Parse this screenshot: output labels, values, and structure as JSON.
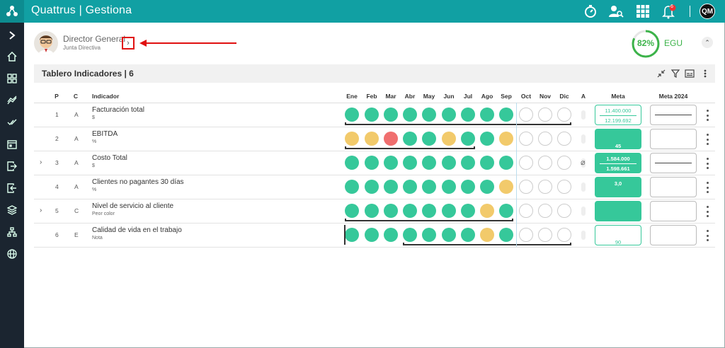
{
  "app": {
    "title": "Quattrus | Gestiona",
    "user_initials": "QM",
    "notifications": "6"
  },
  "profile": {
    "role": "Director General",
    "unit": "Junta Directiva",
    "score": "82%",
    "score_value": 82,
    "score_label": "EGU"
  },
  "panel": {
    "title": "Tablero Indicadores | 6"
  },
  "columns": {
    "p": "P",
    "c": "C",
    "indicador": "Indicador",
    "months": [
      "Ene",
      "Feb",
      "Mar",
      "Abr",
      "May",
      "Jun",
      "Jul",
      "Ago",
      "Sep",
      "Oct",
      "Nov",
      "Dic"
    ],
    "a": "A",
    "meta": "Meta",
    "meta_year": "Meta 2024"
  },
  "rows": [
    {
      "p": "1",
      "c": "A",
      "name": "Facturación total",
      "unit": "$",
      "status": [
        "g",
        "g",
        "g",
        "g",
        "g",
        "g",
        "g",
        "g",
        "g",
        "e",
        "e",
        "e"
      ],
      "meta_top": "11.400.000",
      "meta_bottom": "12.199.692",
      "meta_style": "outline2",
      "expand": false
    },
    {
      "p": "2",
      "c": "A",
      "name": "EBITDA",
      "unit": "%",
      "status": [
        "y",
        "y",
        "r",
        "g",
        "g",
        "y",
        "g",
        "g",
        "y",
        "e",
        "e",
        "e"
      ],
      "meta_top": "",
      "meta_bottom": "45",
      "meta_style": "fill",
      "expand": false
    },
    {
      "p": "3",
      "c": "A",
      "name": "Costo Total",
      "unit": "$",
      "status": [
        "g",
        "g",
        "g",
        "g",
        "g",
        "g",
        "g",
        "g",
        "g",
        "e",
        "e",
        "e"
      ],
      "meta_top": "1.584.000",
      "meta_bottom": "1.598.661",
      "meta_style": "fill2",
      "expand": true
    },
    {
      "p": "4",
      "c": "A",
      "name": "Clientes no pagantes 30 días",
      "unit": "%",
      "status": [
        "g",
        "g",
        "g",
        "g",
        "g",
        "g",
        "g",
        "g",
        "y",
        "e",
        "e",
        "e"
      ],
      "meta_top": "3,0",
      "meta_bottom": "",
      "meta_style": "filltop",
      "expand": false
    },
    {
      "p": "5",
      "c": "C",
      "name": "Nivel de servicio al cliente",
      "unit": "Peor color",
      "status": [
        "g",
        "g",
        "g",
        "g",
        "g",
        "g",
        "g",
        "y",
        "g",
        "e",
        "e",
        "e"
      ],
      "meta_top": "",
      "meta_bottom": "",
      "meta_style": "fill",
      "expand": true
    },
    {
      "p": "6",
      "c": "E",
      "name": "Calidad de vida en el trabajo",
      "unit": "Nota",
      "status": [
        "g",
        "g",
        "g",
        "g",
        "g",
        "g",
        "g",
        "y",
        "g",
        "e",
        "e",
        "e"
      ],
      "meta_top": "",
      "meta_bottom": "90",
      "meta_style": "outline",
      "expand": false
    }
  ]
}
